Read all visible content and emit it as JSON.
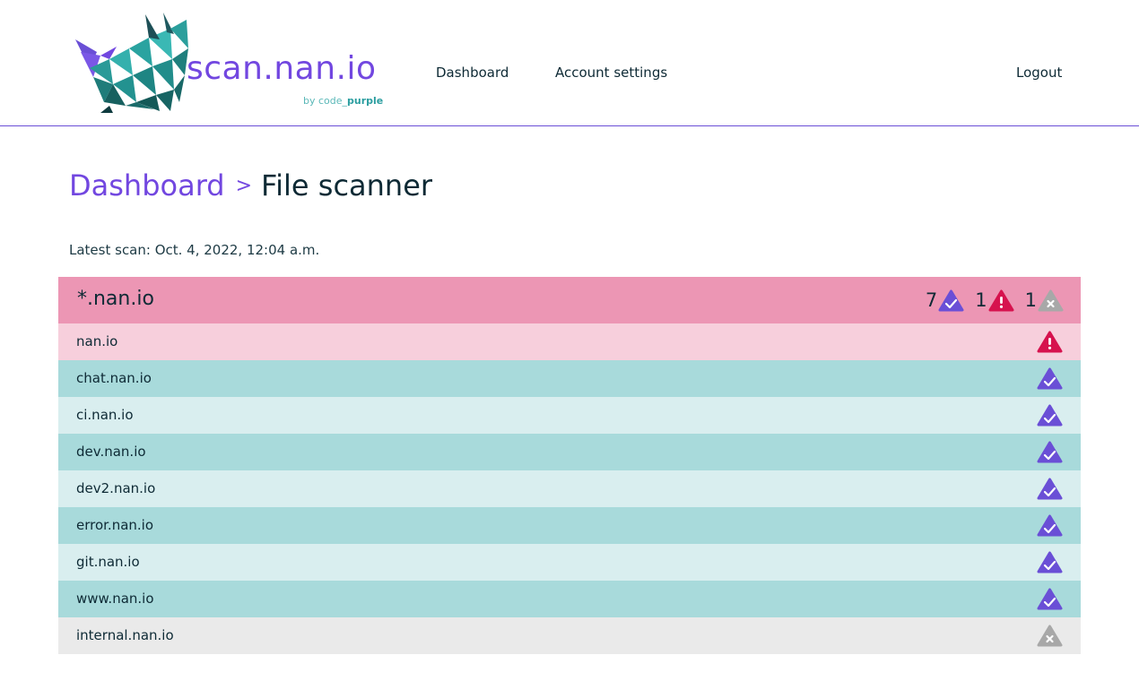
{
  "header": {
    "logo_text": "scan.nan.io",
    "logo_by": "by code",
    "logo_brand": "purple",
    "nav": {
      "dashboard": "Dashboard",
      "account_settings": "Account settings",
      "logout": "Logout"
    }
  },
  "breadcrumb": {
    "parent": "Dashboard",
    "separator": ">",
    "current": "File scanner"
  },
  "latest_scan": "Latest scan: Oct. 4, 2022, 12:04 a.m.",
  "domain": {
    "name": "*.nan.io",
    "summary": {
      "ok_count": "7",
      "warning_count": "1",
      "error_count": "1"
    },
    "rows": [
      {
        "label": "nan.io",
        "status": "warning-icon"
      },
      {
        "label": "chat.nan.io",
        "status": "check-icon"
      },
      {
        "label": "ci.nan.io",
        "status": "check-icon"
      },
      {
        "label": "dev.nan.io",
        "status": "check-icon"
      },
      {
        "label": "dev2.nan.io",
        "status": "check-icon"
      },
      {
        "label": "error.nan.io",
        "status": "check-icon"
      },
      {
        "label": "git.nan.io",
        "status": "check-icon"
      },
      {
        "label": "www.nan.io",
        "status": "check-icon"
      },
      {
        "label": "internal.nan.io",
        "status": "error-icon"
      }
    ]
  },
  "colors": {
    "accent": "#7247e0",
    "ok": "#6a4fd6",
    "warning": "#d6124e",
    "error": "#a8a8a8",
    "domain_header": "#ec96b4"
  }
}
